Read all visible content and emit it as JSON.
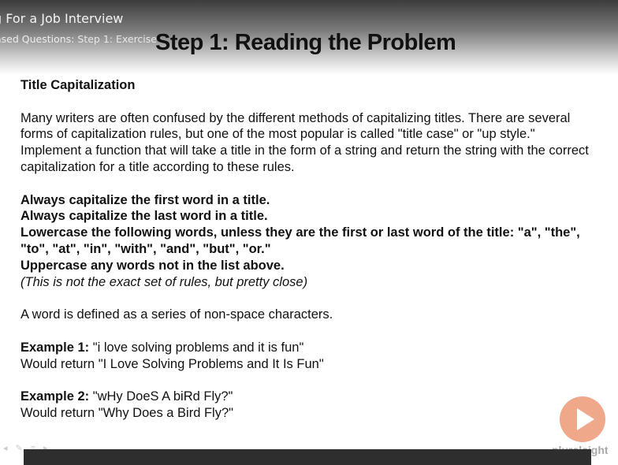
{
  "header": {
    "course_title": "g For a Job Interview",
    "module_prefix": "ased Questions:",
    "clip_title": "Step 1: Exercise"
  },
  "slide": {
    "title": "Step 1: Reading the Problem",
    "heading": "Title Capitalization",
    "intro": "Many writers are often confused by the different methods of capitalizing titles. There are several forms of capitalization rules, but one of the most popular is called \"title case\" or \"up style.\" Implement a function that will take a title in the form of a string and return the string with the correct capitalization for a title according to these rules.",
    "rules": [
      "Always capitalize the first word in a title.",
      "Always capitalize the last word in a title.",
      "Lowercase the following words, unless they are the first or last word of the title: \"a\", \"the\", \"to\", \"at\", \"in\", \"with\", \"and\", \"but\", \"or.\"",
      "Uppercase any words not in the list above."
    ],
    "rules_note": "(This is not the exact set of rules, but pretty close)",
    "word_def": "A word is defined as a series of non-space characters.",
    "examples": [
      {
        "label": "Example 1:",
        "input": " \"i love solving problems and it is fun\"",
        "output": "Would return \"I Love Solving Problems and It Is Fun\""
      },
      {
        "label": "Example 2:",
        "input": " \"wHy DoeS A biRd Fly?\"",
        "output": "Would return \"Why Does a Bird Fly?\""
      }
    ]
  },
  "brand": "pluralsight",
  "nav_icons": [
    "arrow-left-icon",
    "pen-icon",
    "menu-icon",
    "arrow-right-icon"
  ]
}
